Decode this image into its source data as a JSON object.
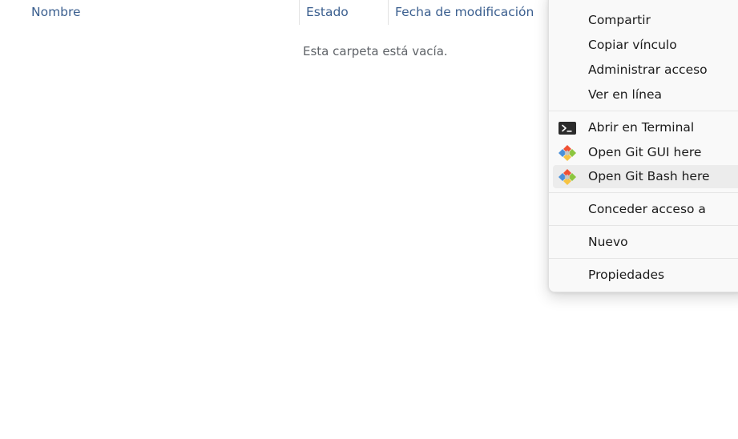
{
  "file_list": {
    "columns": {
      "name": "Nombre",
      "status": "Estado",
      "modified": "Fecha de modificación"
    },
    "empty_message": "Esta carpeta está vacía."
  },
  "context_menu": {
    "items": [
      {
        "label": "Compartir"
      },
      {
        "label": "Copiar vínculo"
      },
      {
        "label": "Administrar acceso"
      },
      {
        "label": "Ver en línea"
      },
      {
        "label": "Abrir en Terminal",
        "icon": "terminal-icon"
      },
      {
        "label": "Open Git GUI here",
        "icon": "git-icon"
      },
      {
        "label": "Open Git Bash here",
        "icon": "git-icon",
        "hovered": true
      },
      {
        "label": "Conceder acceso a"
      },
      {
        "label": "Nuevo"
      },
      {
        "label": "Propiedades"
      }
    ]
  },
  "colors": {
    "header_text": "#3b5f8f",
    "menu_hover": "#ececec",
    "menu_background": "#f9f9f9"
  }
}
